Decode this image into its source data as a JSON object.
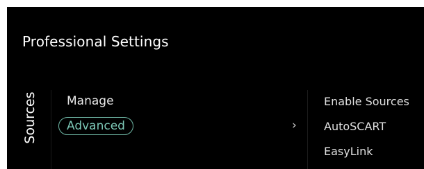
{
  "header": {
    "title": "Professional Settings"
  },
  "section": {
    "label": "Sources"
  },
  "menu": {
    "items": [
      {
        "label": "Manage",
        "selected": false
      },
      {
        "label": "Advanced",
        "selected": true
      }
    ],
    "chevron": "›"
  },
  "submenu": {
    "items": [
      {
        "label": "Enable Sources"
      },
      {
        "label": "AutoSCART"
      },
      {
        "label": "EasyLink"
      }
    ]
  },
  "colors": {
    "background": "#000000",
    "text": "#ffffff",
    "accent": "#7cc7b6"
  },
  "icons": {
    "chevron": "chevron-right-icon"
  }
}
